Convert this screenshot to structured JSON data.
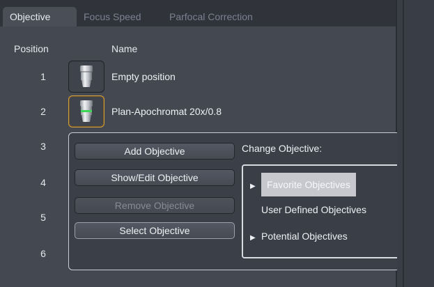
{
  "tabs": [
    "Objective",
    "Focus Speed",
    "Parfocal Correction"
  ],
  "columns": {
    "position": "Position",
    "name": "Name"
  },
  "positions": [
    "1",
    "2",
    "3",
    "4",
    "5",
    "6"
  ],
  "objectives": [
    {
      "name": "Empty position",
      "icon": "objective-lens-icon",
      "ring": "none"
    },
    {
      "name": "Plan-Apochromat 20x/0.8",
      "icon": "objective-lens-icon",
      "ring": "#3fd75a"
    }
  ],
  "popup": {
    "buttons": {
      "add": "Add Objective",
      "show_edit": "Show/Edit Objective",
      "remove": "Remove Objective",
      "select": "Select Objective"
    },
    "change_label": "Change Objective:",
    "tree": {
      "favorite": "Favorite Objectives",
      "user_defined": "User Defined Objectives",
      "potential": "Potential Objectives"
    }
  },
  "colors": {
    "selection_border": "#d6a040",
    "panel_bg": "#444851",
    "highlight": "#c6c8cd"
  }
}
